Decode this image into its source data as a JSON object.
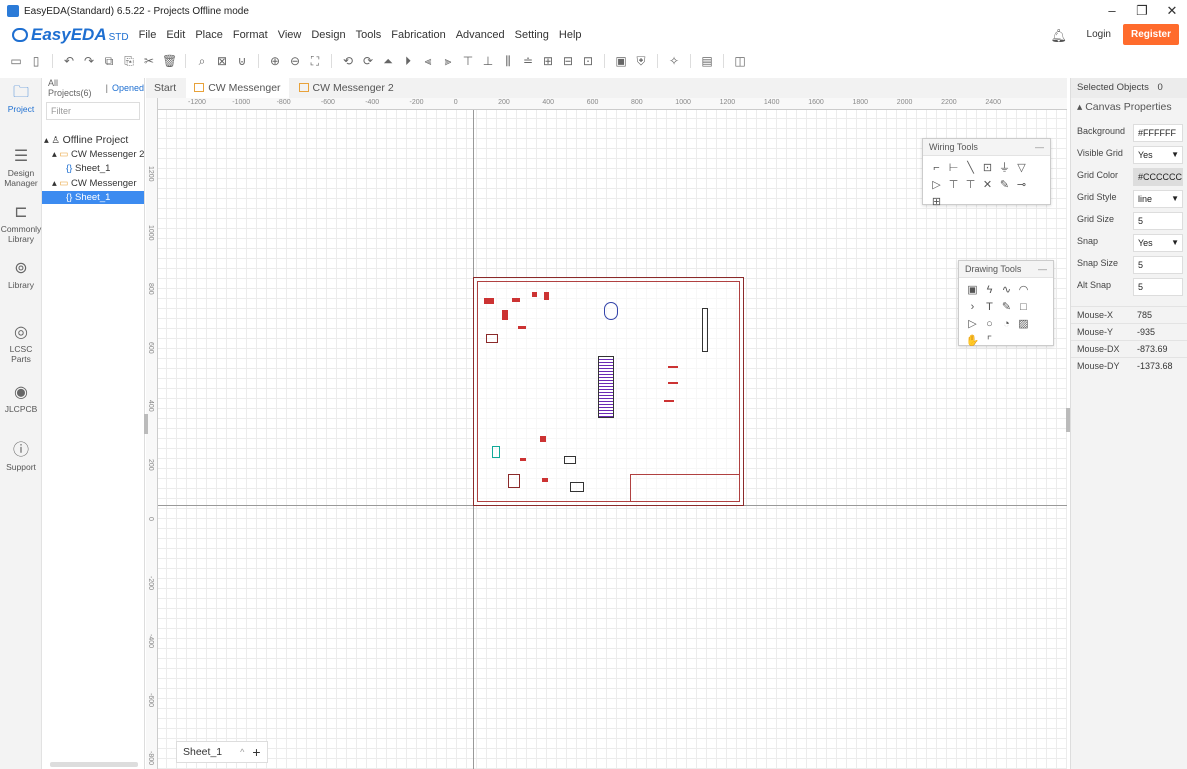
{
  "window": {
    "title": "EasyEDA(Standard) 6.5.22 - Projects Offline mode",
    "minimize": "–",
    "maximize": "❐",
    "close": "✕"
  },
  "header": {
    "logo_text": "EasyEDA",
    "logo_std": "STD",
    "menu": [
      "File",
      "Edit",
      "Place",
      "Format",
      "View",
      "Design",
      "Tools",
      "Fabrication",
      "Advanced",
      "Setting",
      "Help"
    ],
    "login": "Login",
    "register": "Register",
    "accent": "#1e6fd1",
    "register_color": "#ff6b2c"
  },
  "leftbar": {
    "items": [
      {
        "label": "Project",
        "icon": "folder-icon"
      },
      {
        "label": "Design Manager",
        "icon": "tree-icon"
      },
      {
        "label": "Commonly Library",
        "icon": "chip-icon"
      },
      {
        "label": "Library",
        "icon": "search-lib-icon"
      },
      {
        "label": "LCSC Parts",
        "icon": "lcsc-icon"
      },
      {
        "label": "JLCPCB",
        "icon": "jlc-icon"
      },
      {
        "label": "Support",
        "icon": "help-icon"
      }
    ]
  },
  "project_panel": {
    "tab_all": "All Projects(6)",
    "separator": "|",
    "tab_opened": "Opened",
    "filter_placeholder": "Filter",
    "tree": [
      {
        "label": "Offline Project",
        "level": 0
      },
      {
        "label": "CW Messenger 2",
        "level": 1
      },
      {
        "label": "Sheet_1",
        "level": 2
      },
      {
        "label": "CW Messenger",
        "level": 1
      },
      {
        "label": "Sheet_1",
        "level": 2,
        "selected": true
      }
    ]
  },
  "doc_tabs": {
    "start": "Start",
    "tabs": [
      "CW Messenger",
      "CW Messenger 2"
    ],
    "active": "CW Messenger"
  },
  "canvas": {
    "ruler_h": [
      "-1200",
      "-1000",
      "-800",
      "-600",
      "-400",
      "-200",
      "0",
      "200",
      "400",
      "600",
      "800",
      "1000",
      "1200",
      "1400",
      "1600",
      "1800",
      "2000",
      "2200",
      "2400"
    ],
    "ruler_v": [
      "1200",
      "1000",
      "800",
      "600",
      "400",
      "200",
      "0",
      "-200",
      "-400",
      "-600",
      "-800"
    ],
    "sheet_tab": "Sheet_1",
    "wiring_tools_title": "Wiring Tools",
    "drawing_tools_title": "Drawing Tools",
    "panel_min": "—"
  },
  "properties": {
    "selected_label": "Selected Objects",
    "selected_count": "0",
    "section": "Canvas Properties",
    "rows": [
      {
        "label": "Background",
        "value": "#FFFFFF"
      },
      {
        "label": "Visible Grid",
        "value": "Yes",
        "dropdown": true
      },
      {
        "label": "Grid Color",
        "value": "#CCCCCC"
      },
      {
        "label": "Grid Style",
        "value": "line",
        "dropdown": true
      },
      {
        "label": "Grid Size",
        "value": "5"
      },
      {
        "label": "Snap",
        "value": "Yes",
        "dropdown": true
      },
      {
        "label": "Snap Size",
        "value": "5"
      },
      {
        "label": "Alt Snap",
        "value": "5"
      }
    ],
    "mouse": [
      {
        "label": "Mouse-X",
        "value": "785"
      },
      {
        "label": "Mouse-Y",
        "value": "-935"
      },
      {
        "label": "Mouse-DX",
        "value": "-873.69"
      },
      {
        "label": "Mouse-DY",
        "value": "-1373.68"
      }
    ]
  }
}
